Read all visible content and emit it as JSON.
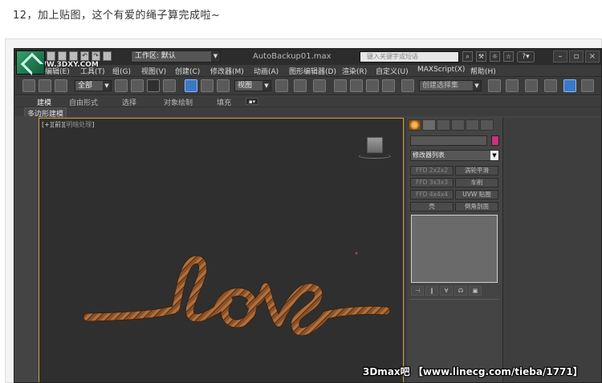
{
  "caption": "12，加上贴图，这个有爱的绳子算完成啦~",
  "titlebar": {
    "workspace_label": "工作区: 默认",
    "app_title": "AutoBackup01.max",
    "search_placeholder": "键入关键字或短语",
    "help_label": "?"
  },
  "menu": {
    "items": [
      "编辑(E)",
      "工具(T)",
      "组(G)",
      "视图(V)",
      "创建(C)",
      "修改器(M)",
      "动画(A)",
      "图形编辑器(D)",
      "渲染(R)",
      "自定义(U)",
      "MAXScript(X)",
      "帮助(H)"
    ]
  },
  "toolbar": {
    "filter_value": "全部",
    "ref_coord_value": "视图",
    "named_selection_placeholder": "创建选择集"
  },
  "ribbon": {
    "tabs": [
      "建模",
      "自由形式",
      "选择",
      "对象绘制",
      "填充"
    ],
    "subtab": "多边形建模"
  },
  "viewport": {
    "label_bracket": "[+][前][",
    "label_shading": "明暗处理",
    "label_end": "]"
  },
  "command_panel": {
    "modifier_list": "修改器列表",
    "buttons": [
      [
        "FFD 2x2x2",
        "涡轮平滑"
      ],
      [
        "FFD 3x3x3",
        "车削"
      ],
      [
        "FFD 4x4x4",
        "UVW 贴图"
      ],
      [
        "壳",
        "倒角剖面"
      ]
    ]
  },
  "watermarks": {
    "top": "WWW.3DXY.COM",
    "bottom": "3Dmax吧 【www.linecg.com/tieba/1771】"
  },
  "colors": {
    "rope": "#8a5128",
    "viewport_border": "#c9a23a",
    "object_color": "#c8327e"
  }
}
